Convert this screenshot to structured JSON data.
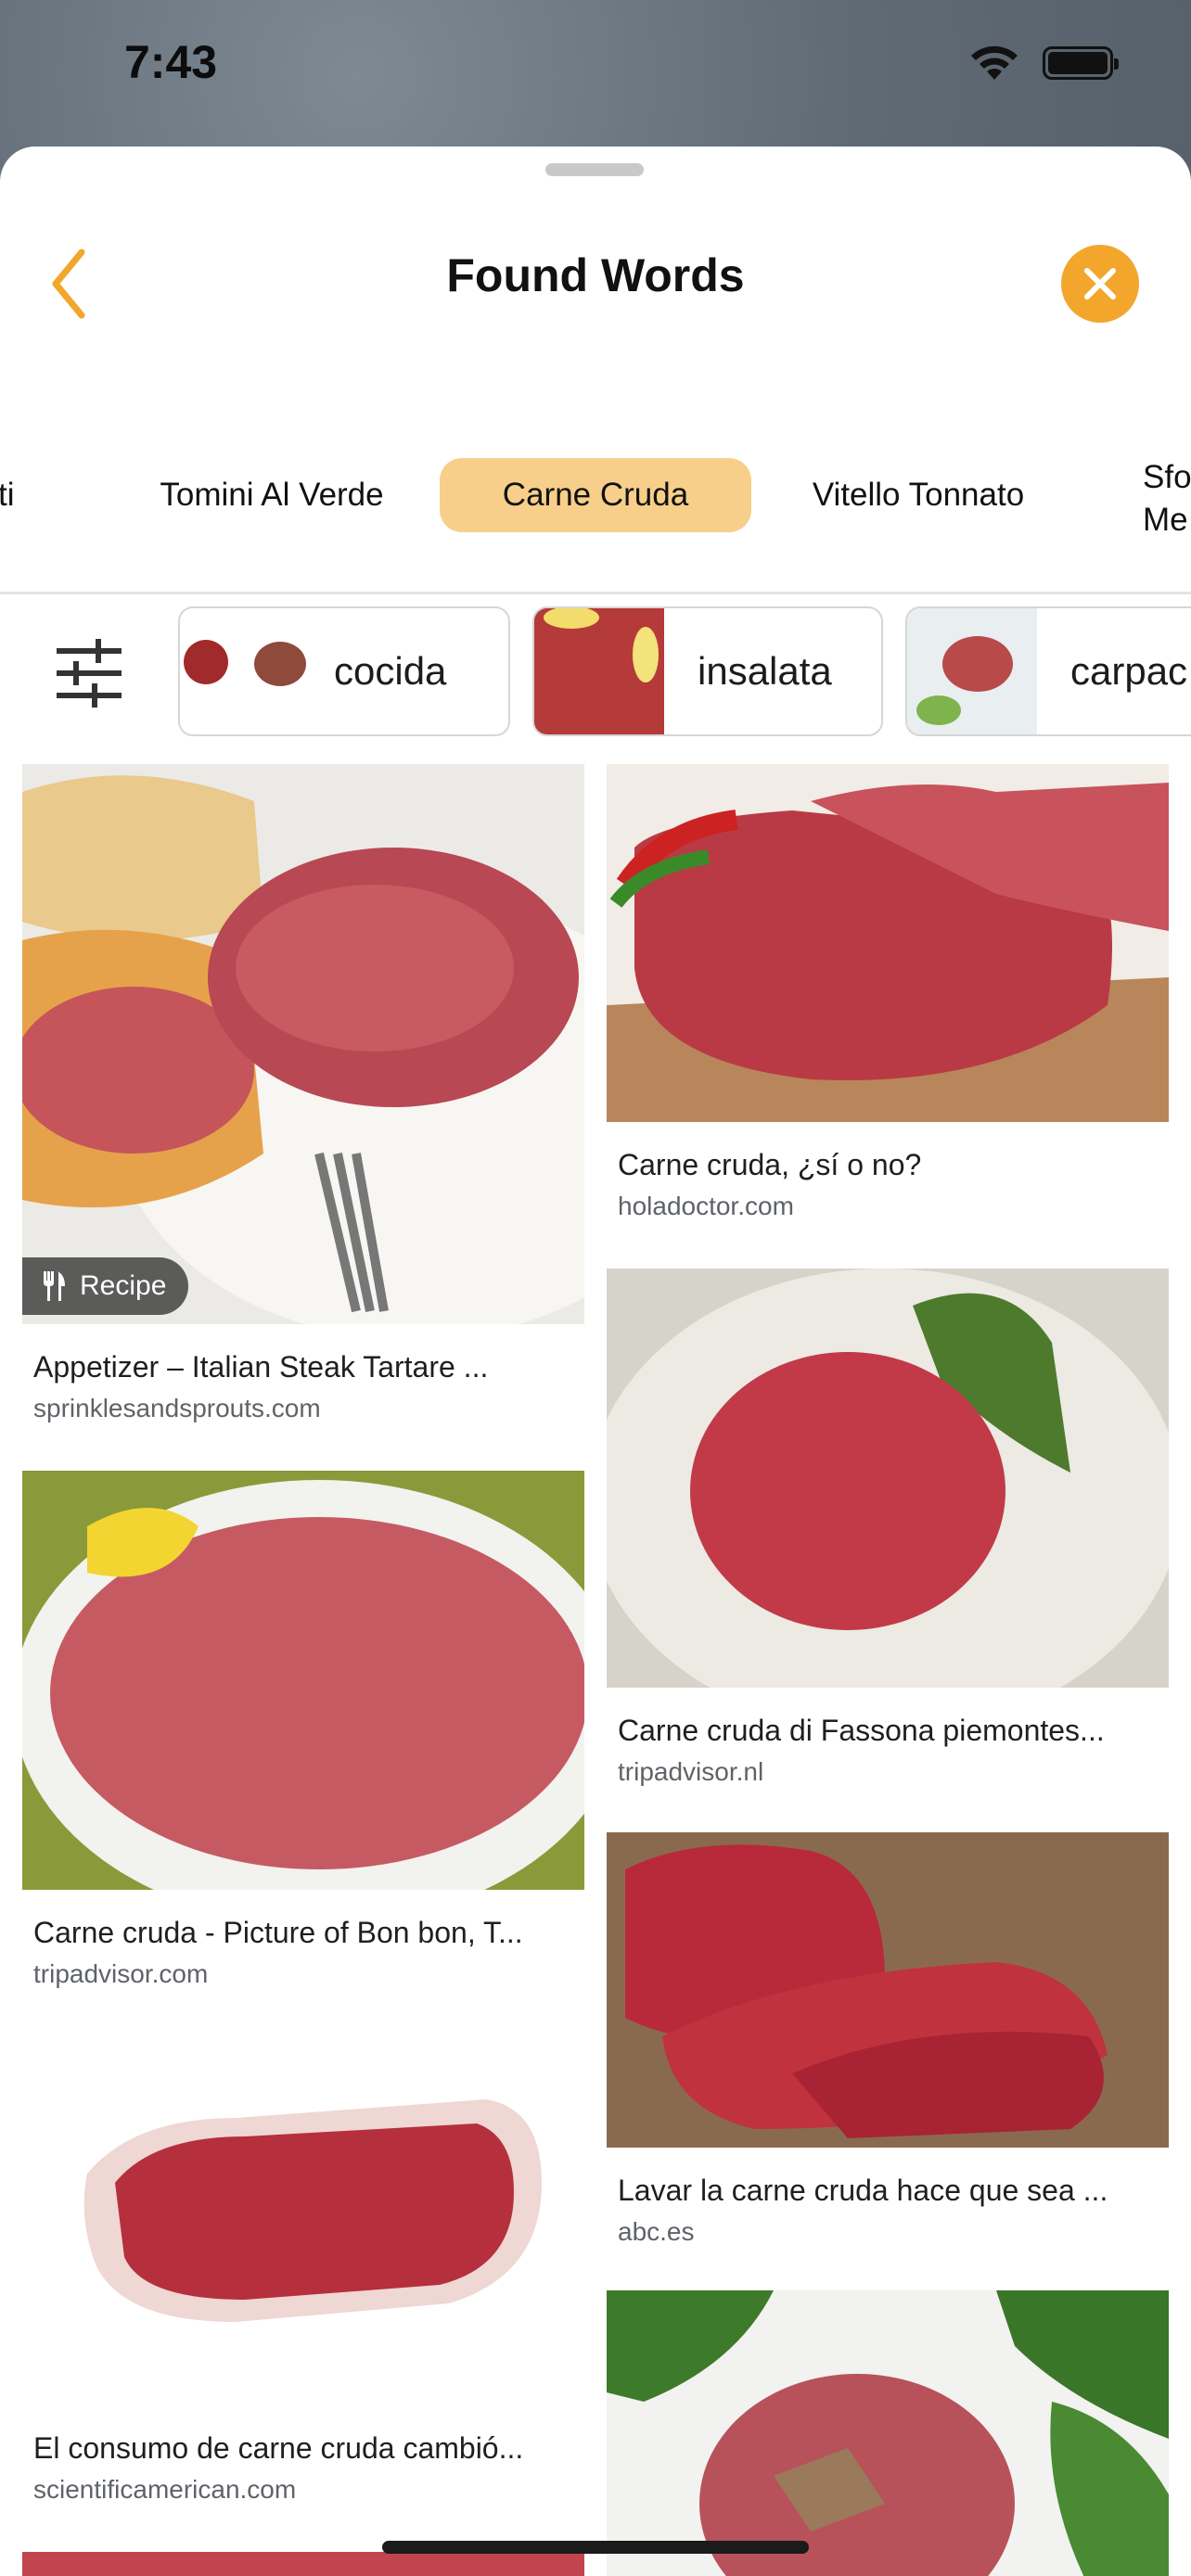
{
  "status_bar": {
    "time": "7:43"
  },
  "header": {
    "title": "Found Words"
  },
  "tabs": [
    {
      "label": "ti"
    },
    {
      "label": "Tomini Al Verde"
    },
    {
      "label": "Carne Cruda",
      "active": true
    },
    {
      "label": "Vitello Tonnato"
    },
    {
      "label": "Sfo",
      "label2": "Me"
    }
  ],
  "chips": [
    {
      "label": "cocida"
    },
    {
      "label": "insalata"
    },
    {
      "label": "carpac"
    }
  ],
  "results": {
    "left": [
      {
        "caption": "Appetizer – Italian Steak Tartare ...",
        "source": "sprinklesandsprouts.com",
        "badge": "Recipe"
      },
      {
        "caption": "Carne cruda - Picture of Bon bon, T...",
        "source": "tripadvisor.com"
      },
      {
        "caption": "El consumo de carne cruda cambió...",
        "source": "scientificamerican.com"
      }
    ],
    "right": [
      {
        "caption": "Carne cruda, ¿sí o no?",
        "source": "holadoctor.com"
      },
      {
        "caption": "Carne cruda di Fassona piemontes...",
        "source": "tripadvisor.nl"
      },
      {
        "caption": "Lavar la carne cruda hace que sea ...",
        "source": "abc.es"
      }
    ]
  },
  "colors": {
    "accent": "#f2a72c",
    "active_tab": "#f7cf8b"
  }
}
